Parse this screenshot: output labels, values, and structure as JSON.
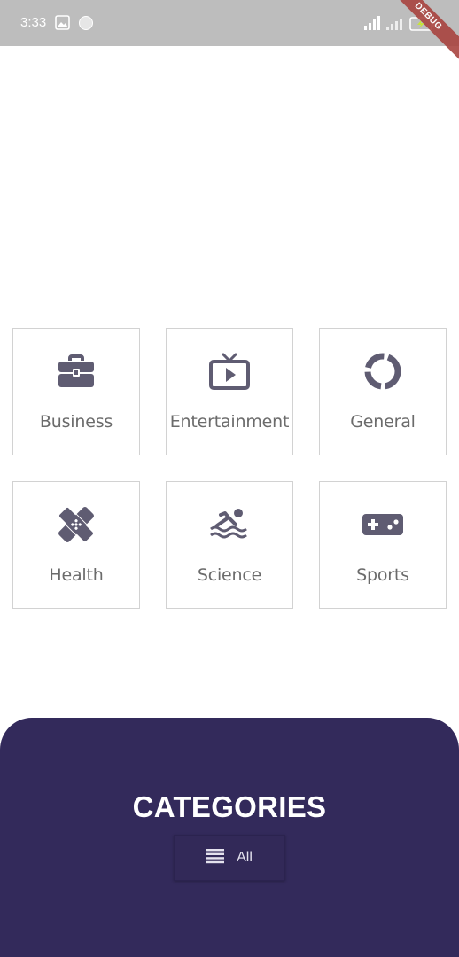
{
  "status_bar": {
    "time": "3:33"
  },
  "debug_banner": {
    "label": "DEBUG"
  },
  "categories": [
    {
      "label": "Business",
      "icon": "briefcase-icon"
    },
    {
      "label": "Entertainment",
      "icon": "tv-icon"
    },
    {
      "label": "General",
      "icon": "ring-icon"
    },
    {
      "label": "Health",
      "icon": "bandage-icon"
    },
    {
      "label": "Science",
      "icon": "swimmer-icon"
    },
    {
      "label": "Sports",
      "icon": "gamepad-icon"
    }
  ],
  "panel": {
    "title": "CATEGORIES",
    "filter_button": {
      "label": "All",
      "icon": "list-icon"
    }
  },
  "colors": {
    "panel_background": "#332a5b",
    "icon": "#5f5c72",
    "label": "#6b6b6b",
    "status_bar": "#bdbdbd"
  }
}
